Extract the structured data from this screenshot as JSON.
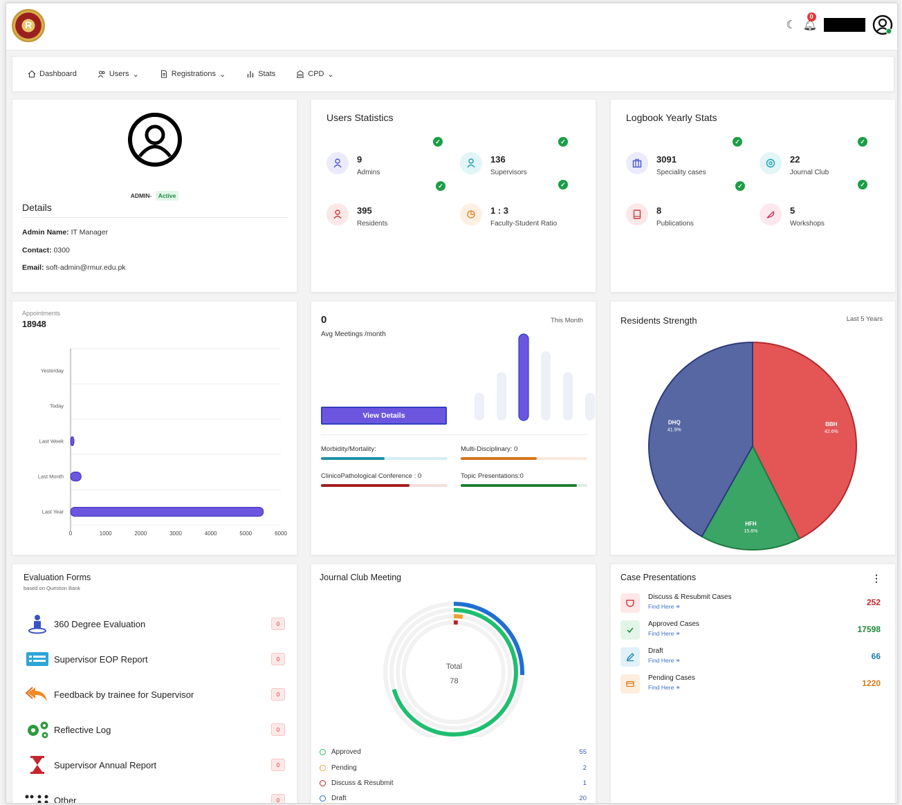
{
  "header": {
    "notification_count": "0"
  },
  "nav": {
    "items": [
      {
        "label": "Dashboard"
      },
      {
        "label": "Users"
      },
      {
        "label": "Registrations"
      },
      {
        "label": "Stats"
      },
      {
        "label": "CPD"
      }
    ]
  },
  "profile": {
    "role": "ADMIN-",
    "status": "Active",
    "title": "Details",
    "name_label": "Admin Name:",
    "name": "IT Manager",
    "contact_label": "Contact:",
    "contact": "0300",
    "email_label": "Email:",
    "email": "soft-admin@rmur.edu.pk"
  },
  "users_stats": {
    "title": "Users Statistics",
    "items": [
      {
        "value": "9",
        "label": "Admins"
      },
      {
        "value": "136",
        "label": "Supervisors"
      },
      {
        "value": "395",
        "label": "Residents"
      },
      {
        "value": "1 : 3",
        "label": "Faculty-Student Ratio"
      }
    ]
  },
  "logbook_stats": {
    "title": "Logbook Yearly Stats",
    "items": [
      {
        "value": "3091",
        "label": "Speciality cases"
      },
      {
        "value": "22",
        "label": "Journal Club"
      },
      {
        "value": "8",
        "label": "Publications"
      },
      {
        "value": "5",
        "label": "Workshops"
      }
    ]
  },
  "appointments": {
    "title": "Appointments",
    "total": "18948"
  },
  "meetings": {
    "value": "0",
    "label": "Avg Meetings /month",
    "period": "This Month",
    "button": "View Details",
    "progress": [
      {
        "label": "Morbidity/Mortality:",
        "fraction": 0.5,
        "color": "#1f8fa8",
        "track": "#d6eef3"
      },
      {
        "label": "Multi-Disciplinary: 0",
        "fraction": 0.6,
        "color": "#d4741f",
        "track": "#fbe9dc"
      },
      {
        "label": "ClinicoPathological Conference : 0",
        "fraction": 0.7,
        "color": "#a31d1d",
        "track": "#f6dede"
      },
      {
        "label": "Topic Presentations:0",
        "fraction": 0.92,
        "color": "#1e7d34",
        "track": "#dcefe1"
      }
    ]
  },
  "residents": {
    "title": "Residents Strength",
    "period": "Last 5 Years"
  },
  "evaluation": {
    "title": "Evaluation Forms",
    "subtitle": "based on Question Bank",
    "items": [
      {
        "label": "360 Degree Evaluation",
        "count": "0"
      },
      {
        "label": "Supervisor EOP Report",
        "count": "0"
      },
      {
        "label": "Feedback by trainee for Supervisor",
        "count": "0"
      },
      {
        "label": "Reflective Log",
        "count": "0"
      },
      {
        "label": "Supervisor Annual Report",
        "count": "0"
      },
      {
        "label": "Other",
        "count": "0"
      }
    ]
  },
  "journal": {
    "title": "Journal Club Meeting",
    "total_label": "Total",
    "total": "78",
    "legend": [
      {
        "label": "Approved",
        "value": "55",
        "color": "#1fbf6f"
      },
      {
        "label": "Pending",
        "value": "2",
        "color": "#f0a030"
      },
      {
        "label": "Discuss & Resubmit",
        "value": "1",
        "color": "#b52222"
      },
      {
        "label": "Draft",
        "value": "20",
        "color": "#1f6fd0"
      }
    ]
  },
  "cases": {
    "title": "Case Presentations",
    "link": "Find Here",
    "items": [
      {
        "label": "Discuss & Resubmit Cases",
        "value": "252",
        "color": "#c62828",
        "bg": "#fde7e7"
      },
      {
        "label": "Approved Cases",
        "value": "17598",
        "color": "#1b8a3a",
        "bg": "#e3f5e8"
      },
      {
        "label": "Draft",
        "value": "66",
        "color": "#1a7fb5",
        "bg": "#e2f1f9"
      },
      {
        "label": "Pending Cases",
        "value": "1220",
        "color": "#d97a16",
        "bg": "#fdeedd"
      }
    ]
  },
  "chart_data": [
    {
      "type": "bar",
      "orientation": "horizontal",
      "categories": [
        "Yesterday",
        "Today",
        "Last Week",
        "Last Month",
        "Last Year"
      ],
      "values": [
        0,
        0,
        60,
        300,
        5500
      ],
      "xlim": [
        0,
        6000
      ],
      "xticks": [
        "0",
        "1000",
        "2000",
        "3000",
        "4000",
        "5000",
        "6000"
      ],
      "color": "#6c56e0"
    },
    {
      "type": "bar",
      "values": [
        40,
        70,
        125,
        100,
        70,
        40
      ],
      "highlight_index": 2,
      "color": "#6c56e0",
      "muted_color": "#eef0f8"
    },
    {
      "type": "pie",
      "slices": [
        {
          "name": "BBH",
          "value": 42.6,
          "label": "42.6%",
          "color": "#e45556"
        },
        {
          "name": "HFH",
          "value": 15.6,
          "label": "15.6%",
          "color": "#3aa565"
        },
        {
          "name": "DHQ",
          "value": 41.9,
          "label": "41.9%",
          "color": "#5667a3"
        }
      ]
    }
  ]
}
